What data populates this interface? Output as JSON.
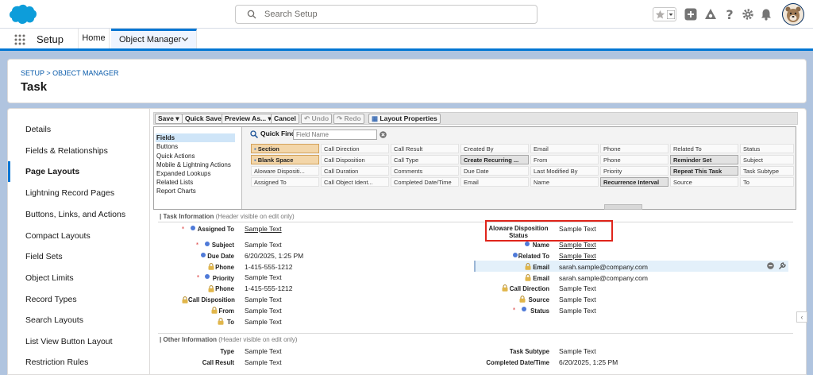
{
  "header": {
    "search_placeholder": "Search Setup",
    "brand_color": "#0176d3"
  },
  "context_bar": {
    "app_name": "Setup",
    "home_label": "Home",
    "object_manager_label": "Object Manager"
  },
  "page_header": {
    "breadcrumb": "SETUP > OBJECT MANAGER",
    "title": "Task"
  },
  "sidebar": {
    "items": [
      {
        "label": "Details"
      },
      {
        "label": "Fields & Relationships"
      },
      {
        "label": "Page Layouts"
      },
      {
        "label": "Lightning Record Pages"
      },
      {
        "label": "Buttons, Links, and Actions"
      },
      {
        "label": "Compact Layouts"
      },
      {
        "label": "Field Sets"
      },
      {
        "label": "Object Limits"
      },
      {
        "label": "Record Types"
      },
      {
        "label": "Search Layouts"
      },
      {
        "label": "List View Button Layout"
      },
      {
        "label": "Restriction Rules"
      }
    ],
    "active_index": 2
  },
  "toolbar": {
    "save": "Save",
    "quick_save": "Quick Save",
    "preview_as": "Preview As...",
    "cancel": "Cancel",
    "undo": "Undo",
    "redo": "Redo",
    "layout_properties": "Layout Properties"
  },
  "palette": {
    "categories": [
      "Fields",
      "Buttons",
      "Quick Actions",
      "Mobile & Lightning Actions",
      "Expanded Lookups",
      "Related Lists",
      "Report Charts"
    ],
    "quick_find_label": "Quick Find",
    "quick_find_placeholder": "Field Name",
    "rows": [
      [
        "Section",
        "Call Direction",
        "Call Result",
        "Created By",
        "Email",
        "Phone",
        "Related To",
        "Status"
      ],
      [
        "Blank Space",
        "Call Disposition",
        "Call Type",
        "Create Recurring ...",
        "From",
        "Phone",
        "Reminder Set",
        "Subject"
      ],
      [
        "Aloware Dispositi...",
        "Call Duration",
        "Comments",
        "Due Date",
        "Last Modified By",
        "Priority",
        "Repeat This Task",
        "Task Subtype"
      ],
      [
        "Assigned To",
        "Call Object Ident...",
        "Completed Date/Time",
        "Email",
        "Name",
        "Recurrence Interval",
        "Source",
        "To"
      ]
    ]
  },
  "layout": {
    "section1_title": "Task Information",
    "section1_note": "(Header visible on edit only)",
    "section2_title": "Other Information",
    "section2_note": "(Header visible on edit only)",
    "left_fields": [
      {
        "label": "Assigned To",
        "value": "Sample Text"
      },
      {
        "label": "Subject",
        "value": "Sample Text"
      },
      {
        "label": "Due Date",
        "value": "6/20/2025, 1:25 PM"
      },
      {
        "label": "Phone",
        "value": "1-415-555-1212"
      },
      {
        "label": "Priority",
        "value": "Sample Text"
      },
      {
        "label": "Phone",
        "value": "1-415-555-1212"
      },
      {
        "label": "Call Disposition",
        "value": "Sample Text"
      },
      {
        "label": "From",
        "value": "Sample Text"
      },
      {
        "label": "To",
        "value": "Sample Text"
      }
    ],
    "right_fields": [
      {
        "label": "Aloware Disposition Status",
        "value": "Sample Text"
      },
      {
        "label": "Name",
        "value": "Sample Text"
      },
      {
        "label": "Related To",
        "value": "Sample Text"
      },
      {
        "label": "Email",
        "value": "sarah.sample@company.com"
      },
      {
        "label": "Email",
        "value": "sarah.sample@company.com"
      },
      {
        "label": "Call Direction",
        "value": "Sample Text"
      },
      {
        "label": "Source",
        "value": "Sample Text"
      },
      {
        "label": "Status",
        "value": "Sample Text"
      }
    ],
    "other_left": [
      {
        "label": "Type",
        "value": "Sample Text"
      },
      {
        "label": "Call Result",
        "value": "Sample Text"
      }
    ],
    "other_right": [
      {
        "label": "Task Subtype",
        "value": "Sample Text"
      },
      {
        "label": "Completed Date/Time",
        "value": "6/20/2025, 1:25 PM"
      }
    ]
  }
}
